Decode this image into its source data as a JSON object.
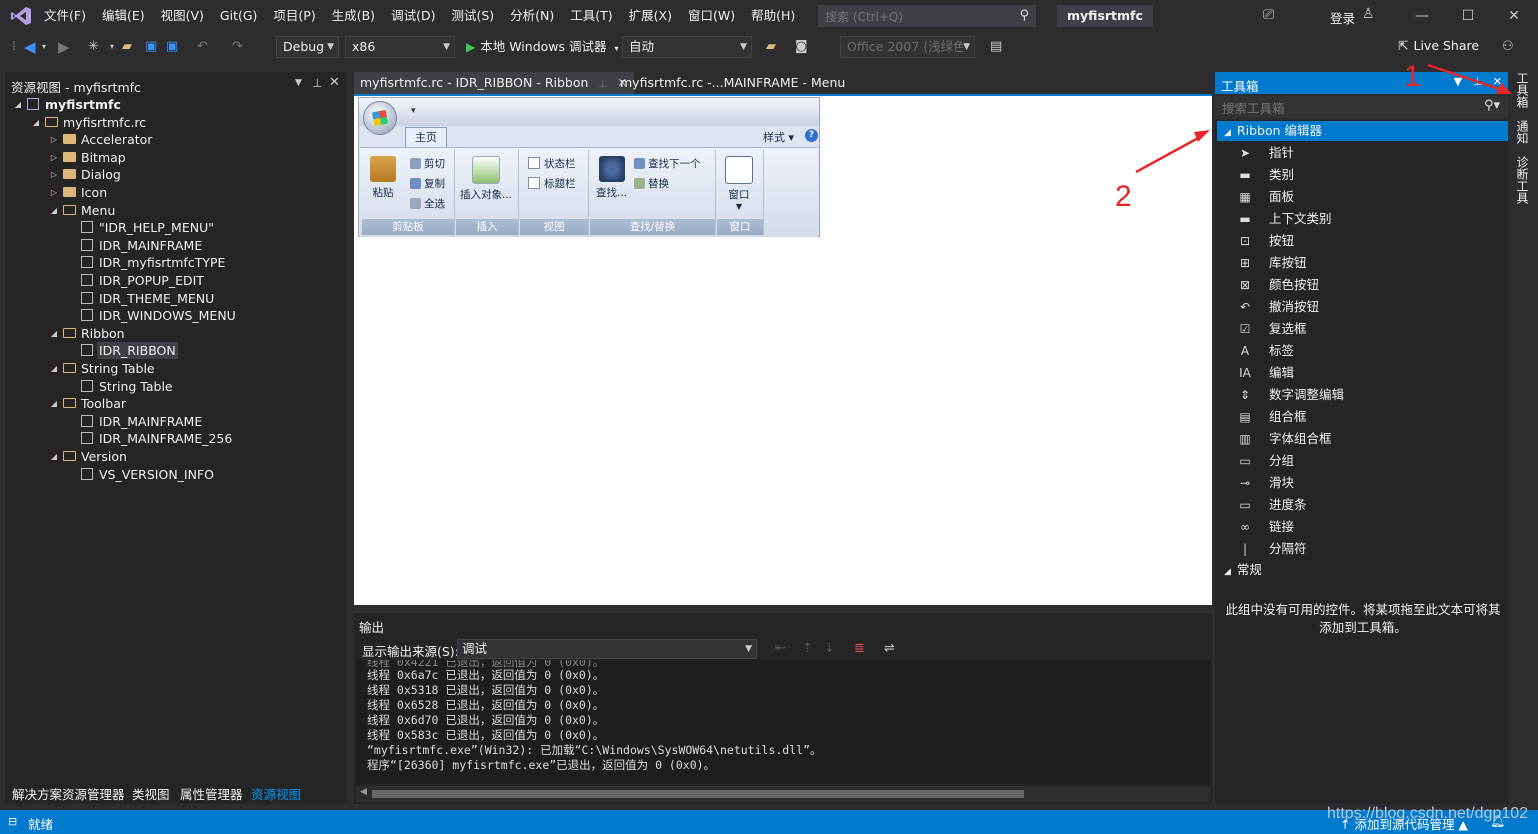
{
  "menubar": {
    "items": [
      "文件(F)",
      "编辑(E)",
      "视图(V)",
      "Git(G)",
      "项目(P)",
      "生成(B)",
      "调试(D)",
      "测试(S)",
      "分析(N)",
      "工具(T)",
      "扩展(X)",
      "窗口(W)",
      "帮助(H)"
    ],
    "search_placeholder": "搜索 (Ctrl+Q)",
    "solution_name": "myfisrtmfc",
    "login": "登录"
  },
  "toolbar": {
    "config": "Debug",
    "platform": "x86",
    "run_label": "本地 Windows 调试器",
    "run_mode": "自动",
    "theme": "Office 2007 (浅绿色",
    "live_share": "Live Share"
  },
  "resource_view": {
    "title": "资源视图 - myfisrtmfc",
    "tree": [
      {
        "label": "myfisrtmfc",
        "level": 0,
        "kind": "project",
        "expanded": true
      },
      {
        "label": "myfisrtmfc.rc",
        "level": 1,
        "kind": "folder",
        "expanded": true
      },
      {
        "label": "Accelerator",
        "level": 2,
        "kind": "folder",
        "expanded": false
      },
      {
        "label": "Bitmap",
        "level": 2,
        "kind": "folder",
        "expanded": false
      },
      {
        "label": "Dialog",
        "level": 2,
        "kind": "folder",
        "expanded": false
      },
      {
        "label": "Icon",
        "level": 2,
        "kind": "folder",
        "expanded": false
      },
      {
        "label": "Menu",
        "level": 2,
        "kind": "folder",
        "expanded": true
      },
      {
        "label": "\"IDR_HELP_MENU\"",
        "level": 3,
        "kind": "item"
      },
      {
        "label": "IDR_MAINFRAME",
        "level": 3,
        "kind": "item"
      },
      {
        "label": "IDR_myfisrtmfcTYPE",
        "level": 3,
        "kind": "item"
      },
      {
        "label": "IDR_POPUP_EDIT",
        "level": 3,
        "kind": "item"
      },
      {
        "label": "IDR_THEME_MENU",
        "level": 3,
        "kind": "item"
      },
      {
        "label": "IDR_WINDOWS_MENU",
        "level": 3,
        "kind": "item"
      },
      {
        "label": "Ribbon",
        "level": 2,
        "kind": "folder",
        "expanded": true
      },
      {
        "label": "IDR_RIBBON",
        "level": 3,
        "kind": "item",
        "selected": true
      },
      {
        "label": "String Table",
        "level": 2,
        "kind": "folder",
        "expanded": true
      },
      {
        "label": "String Table",
        "level": 3,
        "kind": "item"
      },
      {
        "label": "Toolbar",
        "level": 2,
        "kind": "folder",
        "expanded": true
      },
      {
        "label": "IDR_MAINFRAME",
        "level": 3,
        "kind": "item"
      },
      {
        "label": "IDR_MAINFRAME_256",
        "level": 3,
        "kind": "item"
      },
      {
        "label": "Version",
        "level": 2,
        "kind": "folder",
        "expanded": true
      },
      {
        "label": "VS_VERSION_INFO",
        "level": 3,
        "kind": "item"
      }
    ],
    "bottom_tabs": [
      "解决方案资源管理器",
      "类视图",
      "属性管理器",
      "资源视图"
    ]
  },
  "doc_tabs": [
    {
      "label": "myfisrtmfc.rc - IDR_RIBBON - Ribbon",
      "active": true
    },
    {
      "label": "myfisrtmfc.rc -...MAINFRAME - Menu",
      "active": false
    }
  ],
  "ribbon": {
    "tab": "主页",
    "style_label": "样式",
    "help_glyph": "?",
    "groups": {
      "clipboard": {
        "caption": "剪贴板",
        "paste": "粘贴",
        "cut": "剪切",
        "copy": "复制",
        "select_all": "全选"
      },
      "insert": {
        "caption": "插入",
        "insert_object": "插入对象..."
      },
      "view": {
        "caption": "视图",
        "statusbar": "状态栏",
        "titlebar": "标题栏"
      },
      "find": {
        "caption": "查找/替换",
        "find": "查找...",
        "find_next": "查找下一个",
        "replace": "替换"
      },
      "window": {
        "caption": "窗口",
        "window": "窗口"
      }
    }
  },
  "output": {
    "title": "输出",
    "source_label": "显示输出来源(S):",
    "source_value": "调试",
    "lines": [
      "线程 0x6a7c 已退出，返回值为 0 (0x0)。",
      "线程 0x5318 已退出，返回值为 0 (0x0)。",
      "线程 0x6528 已退出，返回值为 0 (0x0)。",
      "线程 0x6d70 已退出，返回值为 0 (0x0)。",
      "线程 0x583c 已退出，返回值为 0 (0x0)。",
      "“myfisrtmfc.exe”(Win32): 已加载“C:\\Windows\\SysWOW64\\netutils.dll”。",
      "程序“[26360] myfisrtmfc.exe”已退出，返回值为 0 (0x0)。"
    ]
  },
  "toolbox": {
    "title": "工具箱",
    "search_placeholder": "搜索工具箱",
    "section_ribbon": "Ribbon 编辑器",
    "items": [
      {
        "label": "指针",
        "icon": "pointer-icon",
        "glyph": "➤"
      },
      {
        "label": "类别",
        "icon": "category-icon",
        "glyph": "▬"
      },
      {
        "label": "面板",
        "icon": "panel-icon",
        "glyph": "▦"
      },
      {
        "label": "上下文类别",
        "icon": "context-category-icon",
        "glyph": "▬"
      },
      {
        "label": "按钮",
        "icon": "button-icon",
        "glyph": "⊡"
      },
      {
        "label": "库按钮",
        "icon": "gallery-button-icon",
        "glyph": "⊞"
      },
      {
        "label": "颜色按钮",
        "icon": "color-button-icon",
        "glyph": "⊠"
      },
      {
        "label": "撤消按钮",
        "icon": "undo-button-icon",
        "glyph": "↶"
      },
      {
        "label": "复选框",
        "icon": "checkbox-icon",
        "glyph": "☑"
      },
      {
        "label": "标签",
        "icon": "label-icon",
        "glyph": "A"
      },
      {
        "label": "编辑",
        "icon": "edit-icon",
        "glyph": "ⅠA"
      },
      {
        "label": "数字调整编辑",
        "icon": "spin-edit-icon",
        "glyph": "⇕"
      },
      {
        "label": "组合框",
        "icon": "combobox-icon",
        "glyph": "▤"
      },
      {
        "label": "字体组合框",
        "icon": "font-combobox-icon",
        "glyph": "▥"
      },
      {
        "label": "分组",
        "icon": "group-icon",
        "glyph": "▭"
      },
      {
        "label": "滑块",
        "icon": "slider-icon",
        "glyph": "⊸"
      },
      {
        "label": "进度条",
        "icon": "progress-icon",
        "glyph": "▭"
      },
      {
        "label": "链接",
        "icon": "link-icon",
        "glyph": "∞"
      },
      {
        "label": "分隔符",
        "icon": "separator-icon",
        "glyph": "|"
      }
    ],
    "section_general": "常规",
    "empty_text_1": "此组中没有可用的控件。将某项拖至此文本可将其",
    "empty_text_2": "添加到工具箱。"
  },
  "side_tabs": [
    "工具箱",
    "通知",
    "诊断工具"
  ],
  "annotations": {
    "one": "1",
    "two": "2"
  },
  "status": {
    "text": "就绪",
    "right": "↑ 添加到源代码管理 ▲",
    "watermark": "https://blog.csdn.net/dgp102"
  },
  "colors": {
    "accent": "#007acc",
    "background": "#2d2d30",
    "panel": "#252526",
    "annotation": "#e8262a"
  }
}
